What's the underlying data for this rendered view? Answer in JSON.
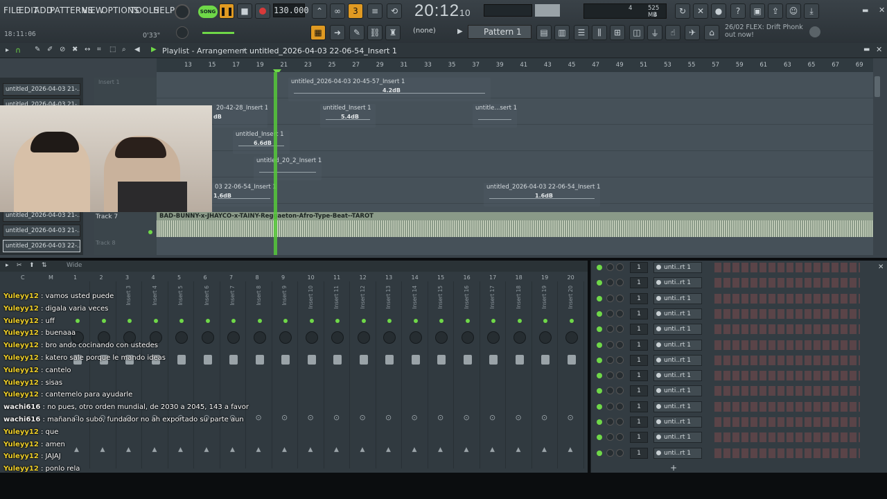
{
  "menu": [
    "FILE",
    "EDIT",
    "ADD",
    "PATTERNS",
    "VIEW",
    "OPTIONS",
    "TOOLS",
    "HELP"
  ],
  "transport": {
    "song_mode": "SONG",
    "bpm": "130.000",
    "time_main": "20:12",
    "time_sub": "10"
  },
  "cpu": {
    "polyphony": "4",
    "memory": "525 MB",
    "voices": "4"
  },
  "hint_bar": {
    "time": "18:11:06",
    "position": "0'33\""
  },
  "pattern": {
    "label": "Pattern 1",
    "selector": "(none)"
  },
  "news": {
    "line1": "26/02  FLEX: Drift Phonk",
    "line2": "out now!"
  },
  "playlist": {
    "title": "Playlist - Arrangement",
    "breadcrumb": "untitled_2026-04-03 22-06-54_Insert 1",
    "ruler": [
      "13",
      "15",
      "17",
      "19",
      "21",
      "23",
      "25",
      "27",
      "29",
      "31",
      "33",
      "35",
      "37",
      "39",
      "41",
      "43",
      "45",
      "47",
      "49",
      "51",
      "53",
      "55",
      "57",
      "59",
      "61",
      "63",
      "65",
      "67",
      "69"
    ],
    "tracks": [
      {
        "name": "untitled_2026-04-03 21-..."
      },
      {
        "name": "untitled_2026-04-03 21-..."
      },
      {
        "name": "untitled_2026-04-03 21-..."
      },
      {
        "name": "untitled_2026-04-03 22-..."
      }
    ],
    "track_headers": [
      "Insert 1",
      "Track 7",
      "Track 8"
    ],
    "clips": [
      {
        "label": "untitled_2026-04-03 20-45-57_Insert 1",
        "db": "4.2dB"
      },
      {
        "label": "20-42-28_Insert 1",
        "db": "dB"
      },
      {
        "label": "untitled_Insert 1",
        "db": "5.4dB"
      },
      {
        "label": "untitle...sert 1",
        "db": ""
      },
      {
        "label": "untitled_Insert 1",
        "db": "6.6dB"
      },
      {
        "label": "untitled_20_2_Insert 1",
        "db": ""
      },
      {
        "label": "03 22-06-54_Insert 1",
        "db": "1.6dB"
      },
      {
        "label": "untitled_2026-04-03 22-06-54_Insert 1",
        "db": "1.6dB"
      }
    ],
    "audio_clip": "BAD-BUNNY-x-JHAYCO-x-TAINY-Reggaeton-Afro-Type-Beat--TAROT"
  },
  "mixer": {
    "mode": "Wide",
    "channels": [
      "C",
      "M",
      "1",
      "2",
      "3",
      "4",
      "5",
      "6",
      "7",
      "8",
      "9",
      "10",
      "11",
      "12",
      "13",
      "14",
      "15",
      "16",
      "17",
      "18",
      "19",
      "20"
    ],
    "inserts": [
      "Insert 3",
      "Insert 4",
      "Insert 5",
      "Insert 6",
      "Insert 7",
      "Insert 8",
      "Insert 9",
      "Insert 10",
      "Insert 11",
      "Insert 12",
      "Insert 13",
      "Insert 14",
      "Insert 15",
      "Insert 16",
      "Insert 17",
      "Insert 18",
      "Insert 19",
      "Insert 20"
    ]
  },
  "chat": [
    {
      "user": "Yuleyy12",
      "msg": "vamos usted puede"
    },
    {
      "user": "Yuleyy12",
      "msg": "digala varia veces"
    },
    {
      "user": "Yuleyy12",
      "msg": "uff"
    },
    {
      "user": "Yuleyy12",
      "msg": "buenaaa"
    },
    {
      "user": "Yuleyy12",
      "msg": "bro ando cocinando con ustedes"
    },
    {
      "user": "Yuleyy12",
      "msg": "katero sale porque le mando ideas"
    },
    {
      "user": "Yuleyy12",
      "msg": "cantelo"
    },
    {
      "user": "Yuleyy12",
      "msg": "sisas"
    },
    {
      "user": "Yuleyy12",
      "msg": "cantemelo para ayudarle"
    },
    {
      "user": "wachi616",
      "msg": "no pues, otro orden mundial, de 2030 a 2045, 143 a favor"
    },
    {
      "user": "wachi616",
      "msg": "mañana lo subo, fundador no ah exportado su parte aun"
    },
    {
      "user": "Yuleyy12",
      "msg": "que"
    },
    {
      "user": "Yuleyy12",
      "msg": "amen"
    },
    {
      "user": "Yuleyy12",
      "msg": "JAJAJ"
    },
    {
      "user": "Yuleyy12",
      "msg": "ponlo rela"
    }
  ],
  "channel_rack": {
    "rows": [
      {
        "num": "1",
        "name": "unti..rt 1"
      },
      {
        "num": "1",
        "name": "unti..rt 1"
      },
      {
        "num": "1",
        "name": "unti..rt 1"
      },
      {
        "num": "1",
        "name": "unti..rt 1"
      },
      {
        "num": "1",
        "name": "unti..rt 1"
      },
      {
        "num": "1",
        "name": "unti..rt 1"
      },
      {
        "num": "1",
        "name": "unti..rt 1"
      },
      {
        "num": "1",
        "name": "unti..rt 1"
      },
      {
        "num": "1",
        "name": "unti..rt 1"
      },
      {
        "num": "1",
        "name": "unti..rt 1"
      },
      {
        "num": "1",
        "name": "unti..rt 1"
      },
      {
        "num": "1",
        "name": "unti..rt 1"
      },
      {
        "num": "1",
        "name": "unti..rt 1"
      }
    ],
    "add_label": "+"
  },
  "colors": {
    "accent_green": "#6fd848",
    "playhead": "#56c93a",
    "chat_user": "#f0d028",
    "record": "#d83a3a"
  }
}
